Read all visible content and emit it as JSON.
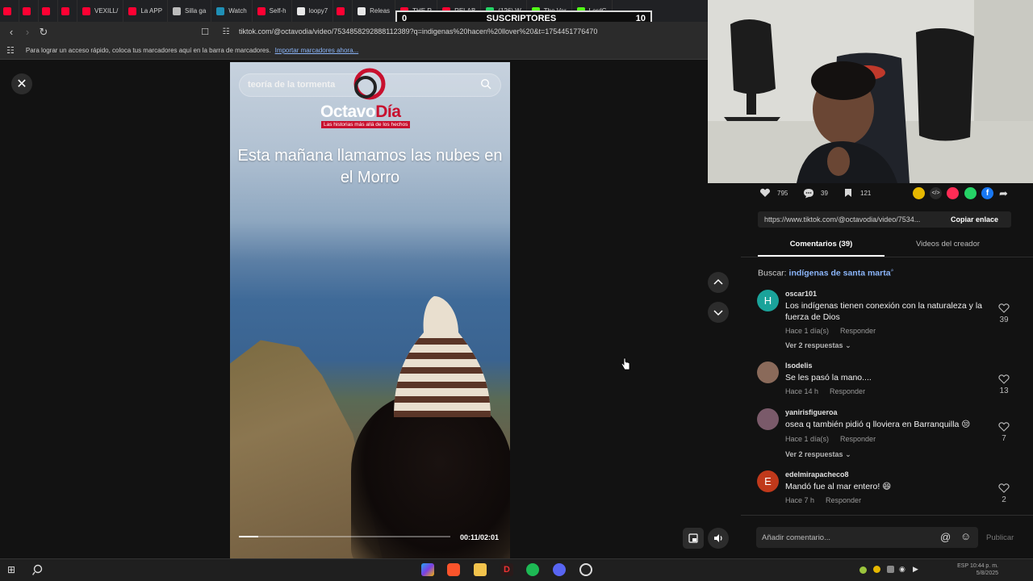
{
  "browser": {
    "tabs": [
      {
        "label": "",
        "color": "#ff0033"
      },
      {
        "label": "",
        "color": "#ff0033"
      },
      {
        "label": "",
        "color": "#ff0033"
      },
      {
        "label": "",
        "color": "#ff0033"
      },
      {
        "label": "VEXILL/",
        "color": "#ff0033"
      },
      {
        "label": "La APP",
        "color": "#ff0033"
      },
      {
        "label": "Silla ga",
        "color": "#bbbbbb"
      },
      {
        "label": "Watch",
        "color": "#1f8fb5"
      },
      {
        "label": "Self-h",
        "color": "#ff0033"
      },
      {
        "label": "loopy7",
        "color": "#e8e8e8"
      },
      {
        "label": "",
        "color": "#ff0033"
      },
      {
        "label": "Releas",
        "color": "#e8e8e8"
      },
      {
        "label": "THE R",
        "color": "#ff0033"
      },
      {
        "label": "RELAB",
        "color": "#ff0033"
      },
      {
        "label": "(126) W",
        "color": "#25d366"
      },
      {
        "label": "The Var",
        "color": "#53fc18"
      },
      {
        "label": "LordG",
        "color": "#53fc18"
      }
    ],
    "url": "tiktok.com/@octavodia/video/7534858292888112389?q=indigenas%20hacen%20llover%20&t=1754451776470",
    "bookmarks_hint": "Para lograr un acceso rápido, coloca tus marcadores aquí en la barra de marcadores.",
    "bookmarks_import": "Importar marcadores ahora..."
  },
  "overlay": {
    "subs_min": "0",
    "subs_label": "SUSCRIPTORES",
    "subs_max": "10"
  },
  "video": {
    "search_text": "teoría de la tormenta",
    "logo_main": "Octavo",
    "logo_accent": "Día",
    "logo_tagline": "Las historias más allá de los hechos",
    "caption": "Esta mañana llamamos las nubes en el Morro",
    "timecode": "00:11/02:01",
    "progress": 0.09
  },
  "stats": {
    "likes": "795",
    "comments": "39",
    "saves": "121"
  },
  "share": {
    "link": "https://www.tiktok.com/@octavodia/video/7534...",
    "copy_label": "Copiar enlace"
  },
  "panel_tabs": {
    "comments": "Comentarios (39)",
    "videos": "Videos del creador"
  },
  "search_suggest": {
    "prefix": "Buscar:",
    "query": "indígenas de santa marta"
  },
  "comments": [
    {
      "avatar": "H",
      "avatar_color": "#1aa39a",
      "user": "oscar101",
      "text": "Los indígenas tienen conexión con la naturaleza y la fuerza de Dios",
      "time": "Hace 1 día(s)",
      "reply": "Responder",
      "replies": "Ver 2 respuestas",
      "likes": "39"
    },
    {
      "avatar": "",
      "avatar_color": "#8a6a5a",
      "user": "Isodelis",
      "text": "Se les pasó la mano....",
      "time": "Hace 14 h",
      "reply": "Responder",
      "replies": "",
      "likes": "13"
    },
    {
      "avatar": "",
      "avatar_color": "#7a5a6a",
      "user": "yanirisfigueroa",
      "text": "osea q también pidió q lloviera en Barranquilla 😒",
      "time": "Hace 1 día(s)",
      "reply": "Responder",
      "replies": "Ver 2 respuestas",
      "likes": "7"
    },
    {
      "avatar": "E",
      "avatar_color": "#c0391b",
      "user": "edelmirapacheco8",
      "text": "Mandó fue al mar entero! 😄",
      "time": "Hace 7 h",
      "reply": "Responder",
      "replies": "",
      "likes": "2"
    }
  ],
  "composer": {
    "placeholder": "Añadir comentario...",
    "publish": "Publicar"
  },
  "taskbar": {
    "icons": [
      "windows-icon",
      "search-icon",
      "copilot-icon",
      "brave-icon",
      "folder-icon",
      "davinci-icon",
      "spotify-icon",
      "discord-icon",
      "obs-icon"
    ],
    "clock": "10:44 p. m.",
    "date": "5/8/2025",
    "lang": "ESP"
  }
}
